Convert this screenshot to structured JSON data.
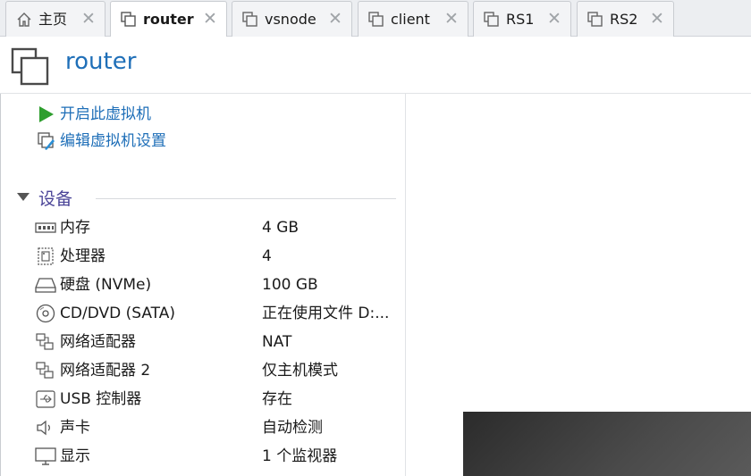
{
  "tabs": [
    {
      "label": "主页",
      "icon": "home-icon"
    },
    {
      "label": "router",
      "icon": "vm-icon"
    },
    {
      "label": "vsnode",
      "icon": "vm-icon"
    },
    {
      "label": "client",
      "icon": "vm-icon"
    },
    {
      "label": "RS1",
      "icon": "vm-icon"
    },
    {
      "label": "RS2",
      "icon": "vm-icon"
    }
  ],
  "active_tab": "router",
  "header": {
    "title": "router"
  },
  "actions": [
    {
      "label": "开启此虚拟机",
      "icon": "play-icon"
    },
    {
      "label": "编辑虚拟机设置",
      "icon": "edit-settings-icon"
    }
  ],
  "devices": {
    "title": "设备",
    "rows": [
      {
        "name": "内存",
        "value": "4 GB",
        "icon": "memory-icon"
      },
      {
        "name": "处理器",
        "value": "4",
        "icon": "cpu-icon"
      },
      {
        "name": "硬盘 (NVMe)",
        "value": "100 GB",
        "icon": "hard-disk-icon"
      },
      {
        "name": "CD/DVD (SATA)",
        "value": "正在使用文件 D:...",
        "icon": "cd-dvd-icon"
      },
      {
        "name": "网络适配器",
        "value": "NAT",
        "icon": "network-adapter-icon"
      },
      {
        "name": "网络适配器 2",
        "value": "仅主机模式",
        "icon": "network-adapter-icon"
      },
      {
        "name": "USB 控制器",
        "value": "存在",
        "icon": "usb-icon"
      },
      {
        "name": "声卡",
        "value": "自动检测",
        "icon": "sound-icon"
      },
      {
        "name": "显示",
        "value": "1 个监视器",
        "icon": "display-icon"
      }
    ]
  },
  "colors": {
    "link": "#1f6fb8",
    "section": "#4b4598",
    "play": "#2e9e2e"
  }
}
